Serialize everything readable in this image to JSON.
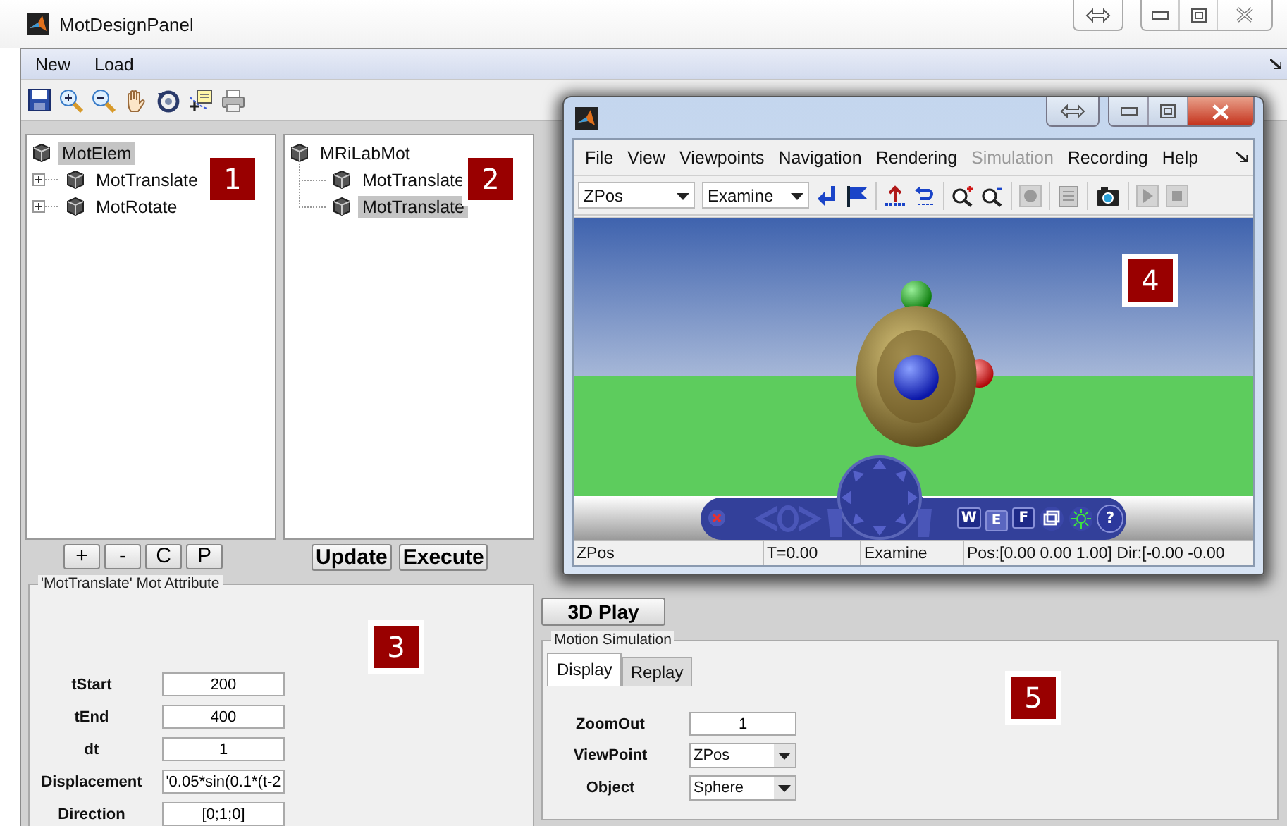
{
  "window": {
    "title": "MotDesignPanel"
  },
  "menu": [
    {
      "label": "New"
    },
    {
      "label": "Load"
    }
  ],
  "trees": [
    {
      "badge": "1",
      "root": {
        "label": "MotElem",
        "selected": true
      },
      "children": [
        {
          "label": "MotTranslate",
          "expanded": false,
          "selected": false
        },
        {
          "label": "MotRotate",
          "expanded": false,
          "selected": false
        }
      ]
    },
    {
      "badge": "2",
      "root": {
        "label": "MRiLabMot",
        "selected": false
      },
      "children": [
        {
          "label": "MotTranslate",
          "selected": false
        },
        {
          "label": "MotTranslate",
          "selected": true
        }
      ]
    }
  ],
  "tree_buttons": [
    "+",
    "-",
    "C",
    "P"
  ],
  "action_buttons": [
    "Update",
    "Execute"
  ],
  "attribute_panel": {
    "title": "'MotTranslate' Mot Attribute",
    "badge": "3",
    "fields": [
      {
        "label": "tStart",
        "value": "200"
      },
      {
        "label": "tEnd",
        "value": "400"
      },
      {
        "label": "dt",
        "value": "1"
      },
      {
        "label": "Displacement",
        "value": "'0.05*sin(0.1*(t-2"
      },
      {
        "label": "Direction",
        "value": "[0;1;0]"
      }
    ]
  },
  "play_button": "3D Play",
  "simulation_panel": {
    "title": "Motion Simulation",
    "badge": "5",
    "tabs": [
      {
        "label": "Display",
        "selected": true
      },
      {
        "label": "Replay",
        "selected": false
      }
    ],
    "fields": [
      {
        "kind": "input",
        "label": "ZoomOut",
        "value": "1"
      },
      {
        "kind": "dropdown",
        "label": "ViewPoint",
        "value": "ZPos"
      },
      {
        "kind": "dropdown",
        "label": "Object",
        "value": "Sphere"
      }
    ]
  },
  "viewer": {
    "badge": "4",
    "menu": [
      {
        "label": "File",
        "disabled": false
      },
      {
        "label": "View",
        "disabled": false
      },
      {
        "label": "Viewpoints",
        "disabled": false
      },
      {
        "label": "Navigation",
        "disabled": false
      },
      {
        "label": "Rendering",
        "disabled": false
      },
      {
        "label": "Simulation",
        "disabled": true
      },
      {
        "label": "Recording",
        "disabled": false
      },
      {
        "label": "Help",
        "disabled": false
      }
    ],
    "viewpoint": "ZPos",
    "mode": "Examine",
    "nav_buttons": [
      {
        "label": "W",
        "selected": false
      },
      {
        "label": "E",
        "selected": true
      },
      {
        "label": "F",
        "selected": false
      }
    ],
    "help": "?",
    "status": [
      "ZPos",
      "T=0.00",
      "Examine",
      "Pos:[0.00 0.00 1.00] Dir:[-0.00 -0.00"
    ]
  }
}
